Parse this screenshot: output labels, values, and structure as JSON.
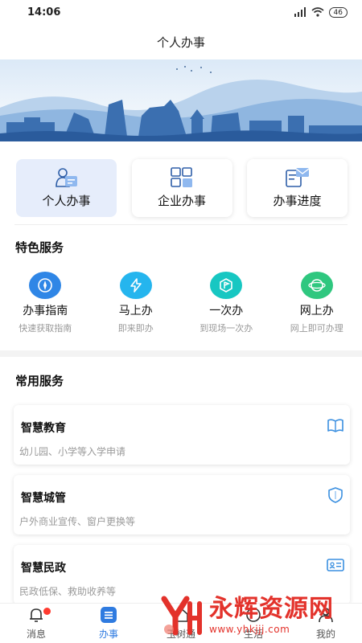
{
  "status_bar": {
    "time": "14:06",
    "battery": "46"
  },
  "header": {
    "title": "个人办事"
  },
  "tiles": [
    {
      "label": "个人办事",
      "icon": "person-card-icon"
    },
    {
      "label": "企业办事",
      "icon": "enterprise-grid-icon"
    },
    {
      "label": "办事进度",
      "icon": "progress-mail-icon"
    }
  ],
  "special": {
    "heading": "特色服务",
    "items": [
      {
        "name": "办事指南",
        "desc": "快速获取指南",
        "icon": "compass-icon",
        "color": "#2f86e6"
      },
      {
        "name": "马上办",
        "desc": "即来即办",
        "icon": "lightning-icon",
        "color": "#25b5ee"
      },
      {
        "name": "一次办",
        "desc": "到现场一次办",
        "icon": "flag-hexagon-icon",
        "color": "#17c7c2"
      },
      {
        "name": "网上办",
        "desc": "网上即可办理",
        "icon": "globe-icon",
        "color": "#2fc77f"
      }
    ]
  },
  "common": {
    "heading": "常用服务",
    "cards": [
      {
        "title": "智慧教育",
        "desc": "幼儿园、小学等入学申请",
        "icon": "book-icon"
      },
      {
        "title": "智慧城管",
        "desc": "户外商业宣传、窗户更换等",
        "icon": "shield-icon"
      },
      {
        "title": "智慧民政",
        "desc": "民政低保、救助收养等",
        "icon": "id-card-icon"
      }
    ]
  },
  "nav": {
    "items": [
      {
        "label": "消息",
        "icon": "bell-icon"
      },
      {
        "label": "办事",
        "icon": "list-icon"
      },
      {
        "label": "玉树通",
        "icon": "home-icon"
      },
      {
        "label": "生活",
        "icon": "life-icon"
      },
      {
        "label": "我的",
        "icon": "user-icon"
      }
    ],
    "active_index": 1
  },
  "watermark": {
    "text": "永辉资源网",
    "url": "www.yhkjjj.com"
  },
  "colors": {
    "accent": "#2f7be0",
    "tile_active_bg": "#e6edfb",
    "badge": "#ff3b30"
  }
}
